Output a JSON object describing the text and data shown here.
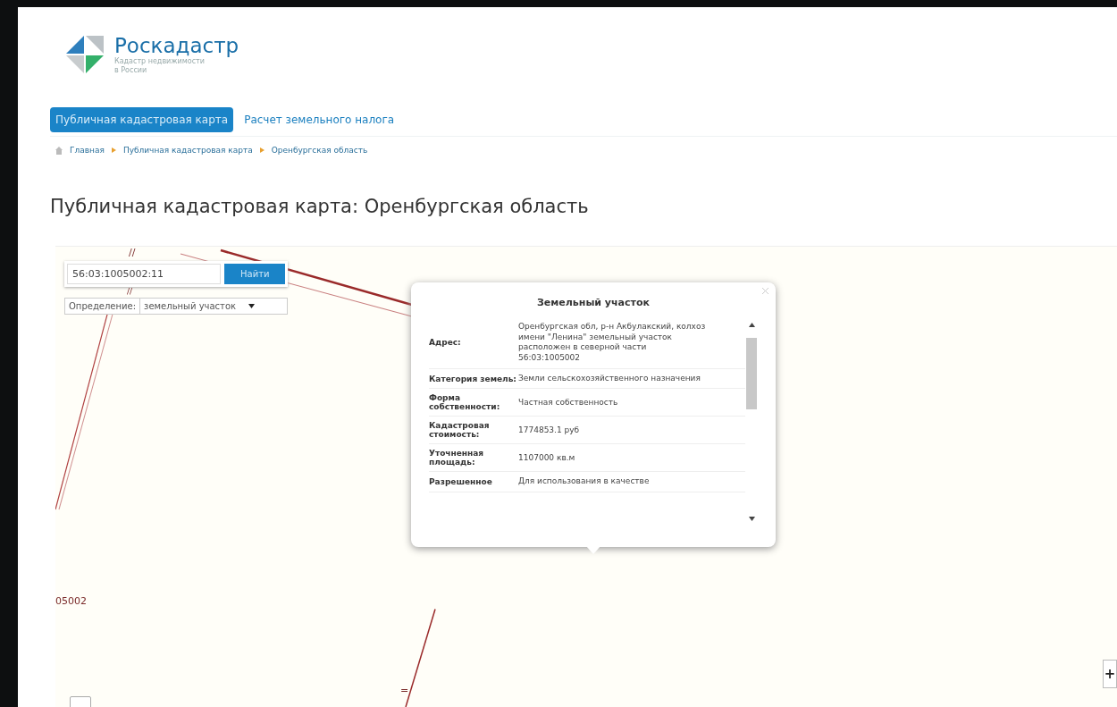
{
  "logo": {
    "title": "Роскадастр",
    "subtitle_lines": [
      "Кадастр недвижимости",
      "в России"
    ]
  },
  "tabs": [
    {
      "label": "Публичная кадастровая карта",
      "selected": true
    },
    {
      "label": "Расчет земельного налога",
      "selected": false
    }
  ],
  "breadcrumbs": [
    "Главная",
    "Публичная кадастровая карта",
    "Оренбургская область"
  ],
  "heading": "Публичная кадастровая карта: Оренбургская область",
  "search": {
    "value": "56:03:1005002:11",
    "button": "Найти"
  },
  "definition": {
    "label": "Определение:",
    "value": "земельный участок"
  },
  "map_labels": [
    "//",
    "//",
    "05002",
    "="
  ],
  "popup": {
    "title": "Земельный участок",
    "rows": [
      {
        "label": "Адрес:",
        "value": "Оренбургская обл, р-н Акбулакский, колхоз имени \"Ленина\" земельный участок расположен в северной части 56:03:1005002"
      },
      {
        "label": "Категория земель:",
        "value": "Земли сельскохозяйственного назначения"
      },
      {
        "label": "Форма собственности:",
        "value": "Частная собственность"
      },
      {
        "label": "Кадастровая стоимость:",
        "value": "1774853.1 руб"
      },
      {
        "label": "Уточненная площадь:",
        "value": "1107000 кв.м"
      },
      {
        "label": "Разрешенное",
        "value": "Для использования в качестве"
      }
    ]
  },
  "zoom": {
    "plus": "+"
  }
}
